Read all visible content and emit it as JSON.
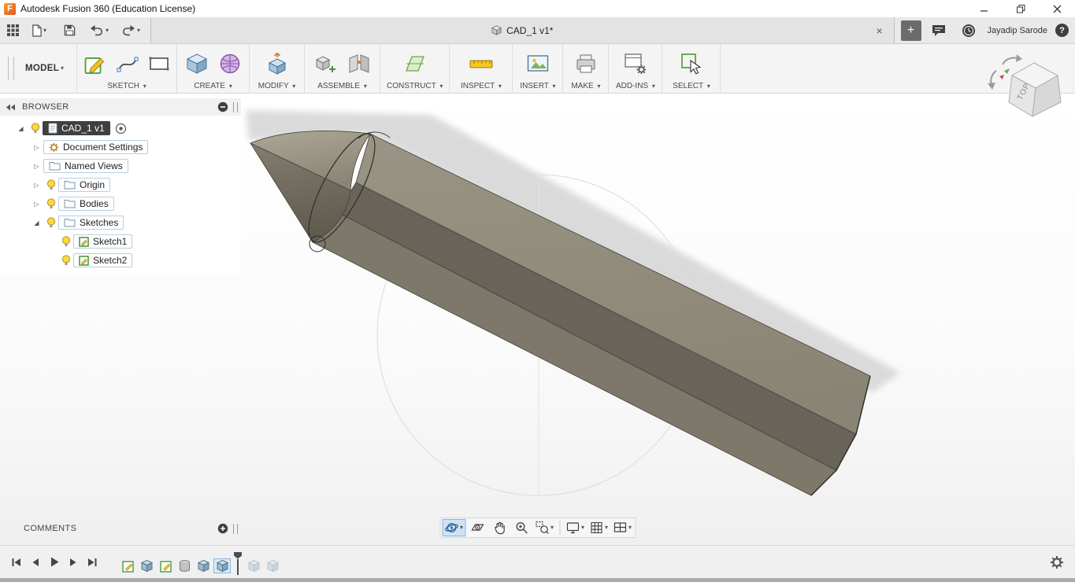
{
  "titlebar": {
    "title": "Autodesk Fusion 360 (Education License)",
    "logo_letter": "F"
  },
  "quickbar": {
    "tab_label": "CAD_1 v1*",
    "user": "Jayadip Sarode",
    "help": "?"
  },
  "icons": {
    "caret": "▾",
    "plus": "+",
    "close": "×",
    "expander_closed": "▷",
    "expander_open": "◢"
  },
  "ribbon": {
    "model": "MODEL",
    "groups": [
      {
        "label": "SKETCH"
      },
      {
        "label": "CREATE"
      },
      {
        "label": "MODIFY"
      },
      {
        "label": "ASSEMBLE"
      },
      {
        "label": "CONSTRUCT"
      },
      {
        "label": "INSPECT"
      },
      {
        "label": "INSERT"
      },
      {
        "label": "MAKE"
      },
      {
        "label": "ADD-INS"
      },
      {
        "label": "SELECT"
      }
    ]
  },
  "browser": {
    "header": "BROWSER",
    "root_label": "CAD_1 v1",
    "items": [
      {
        "label": "Document Settings"
      },
      {
        "label": "Named Views"
      },
      {
        "label": "Origin"
      },
      {
        "label": "Bodies"
      },
      {
        "label": "Sketches"
      },
      {
        "label": "Sketch1"
      },
      {
        "label": "Sketch2"
      }
    ]
  },
  "comments": {
    "header": "COMMENTS"
  },
  "viewcube": {
    "label": "TOP"
  },
  "nav": {
    "items": [
      "orbit",
      "look-at",
      "pan",
      "zoom",
      "zoom-window",
      "display-settings",
      "grid-display",
      "viewports"
    ]
  },
  "timeline": {
    "features": [
      "sketch",
      "extrude",
      "sketch",
      "cylinder",
      "extrude",
      "extrude"
    ],
    "ghost_features": [
      "extrude",
      "extrude"
    ]
  },
  "colors": {
    "accent_blue": "#0696d7",
    "selection_dark": "#3f3f3f",
    "nav_highlight": "#cde3f7",
    "pencil_top": "#8e8a7c",
    "pencil_band": "#68645a",
    "shadow": "#d6d6d6"
  }
}
